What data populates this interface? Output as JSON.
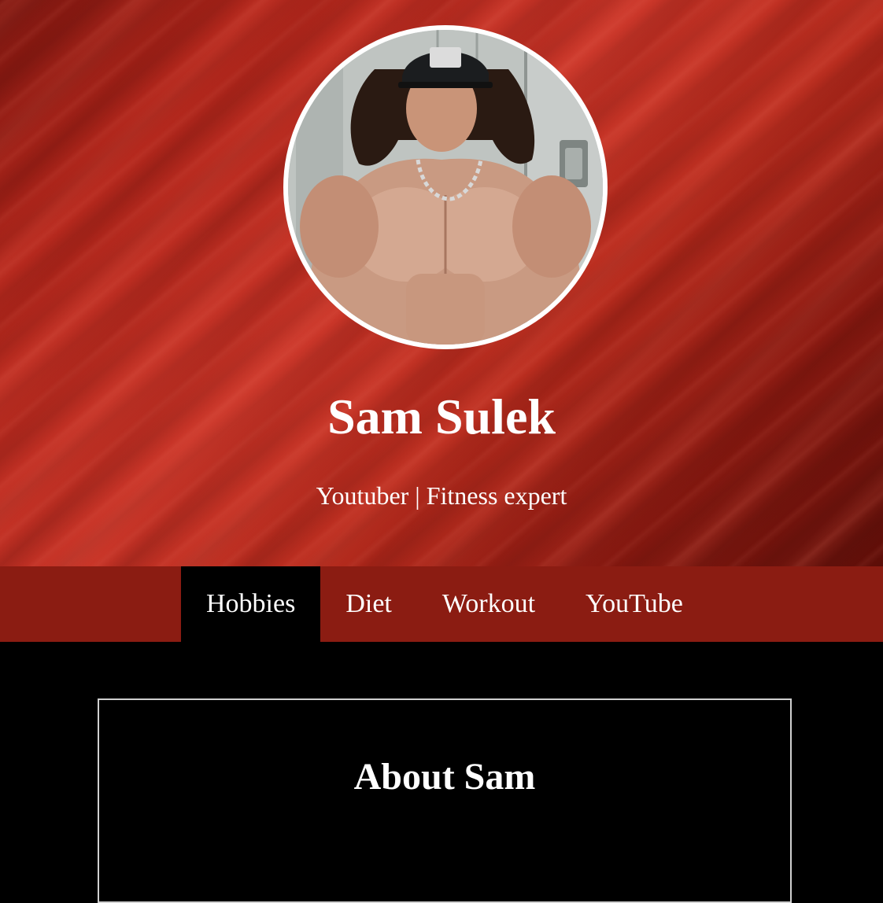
{
  "profile": {
    "name": "Sam Sulek",
    "tagline": "Youtuber | Fitness expert",
    "avatar_icon": "profile-photo"
  },
  "nav": {
    "tabs": [
      {
        "label": "Hobbies",
        "active": true
      },
      {
        "label": "Diet",
        "active": false
      },
      {
        "label": "Workout",
        "active": false
      },
      {
        "label": "YouTube",
        "active": false
      }
    ]
  },
  "about": {
    "title": "About Sam"
  },
  "colors": {
    "hero_red": "#c93528",
    "nav_bg": "#8b1c12",
    "active_tab_bg": "#000000",
    "page_bg": "#000000",
    "text": "#ffffff"
  }
}
